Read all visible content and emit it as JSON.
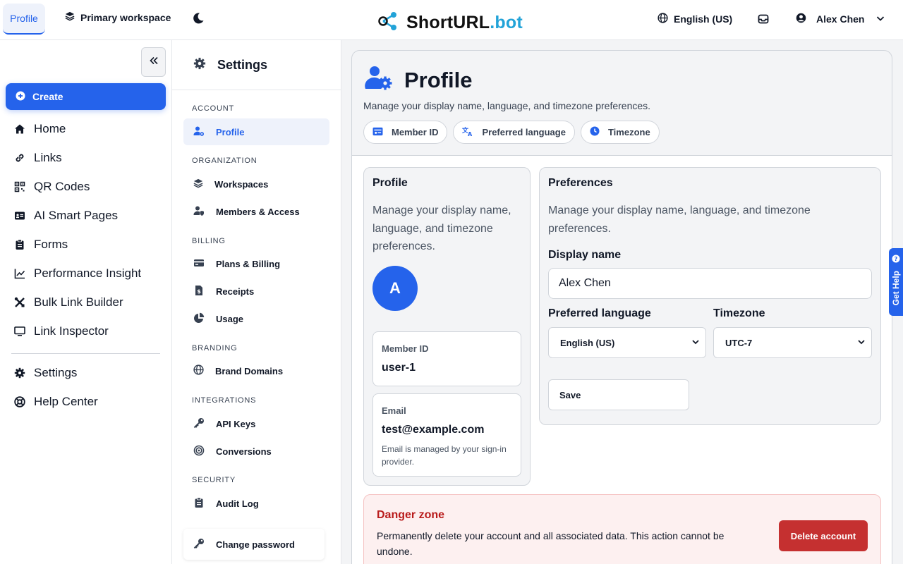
{
  "topbar": {
    "profile_tab": "Profile",
    "workspace": "Primary workspace",
    "brand_main": "ShortURL",
    "brand_accent": ".bot",
    "language": "English (US)",
    "user_name": "Alex Chen"
  },
  "nav": {
    "create": "Create",
    "items": [
      {
        "label": "Home",
        "icon": "home-icon"
      },
      {
        "label": "Links",
        "icon": "link-icon"
      },
      {
        "label": "QR Codes",
        "icon": "qr-code-icon"
      },
      {
        "label": "AI Smart Pages",
        "icon": "id-card-icon"
      },
      {
        "label": "Forms",
        "icon": "clipboard-icon"
      },
      {
        "label": "Performance Insight",
        "icon": "chart-line-icon"
      },
      {
        "label": "Bulk Link Builder",
        "icon": "tools-icon"
      },
      {
        "label": "Link Inspector",
        "icon": "monitor-icon"
      }
    ],
    "bottom_items": [
      {
        "label": "Settings",
        "icon": "gear-icon"
      },
      {
        "label": "Help Center",
        "icon": "lifebuoy-icon"
      }
    ]
  },
  "settings_nav": {
    "title": "Settings",
    "sections": {
      "account": "ACCOUNT",
      "organization": "ORGANIZATION",
      "billing": "BILLING",
      "branding": "BRANDING",
      "integrations": "INTEGRATIONS",
      "security": "SECURITY"
    },
    "items": {
      "profile": "Profile",
      "workspaces": "Workspaces",
      "members": "Members & Access",
      "plans": "Plans & Billing",
      "receipts": "Receipts",
      "usage": "Usage",
      "brand_domains": "Brand Domains",
      "api_keys": "API Keys",
      "conversions": "Conversions",
      "audit_log": "Audit Log",
      "change_password": "Change password"
    }
  },
  "page": {
    "title": "Profile",
    "description": "Manage your display name, language, and timezone preferences.",
    "chips": [
      "Member ID",
      "Preferred language",
      "Timezone"
    ]
  },
  "profile_card": {
    "title": "Profile",
    "description": "Manage your display name, language, and timezone preferences.",
    "avatar_letter": "A",
    "member_id_label": "Member ID",
    "member_id_value": "user-1",
    "email_label": "Email",
    "email_value": "test@example.com",
    "email_note": "Email is managed by your sign-in provider."
  },
  "preferences": {
    "title": "Preferences",
    "description": "Manage your display name, language, and timezone preferences.",
    "display_name_label": "Display name",
    "display_name_value": "Alex Chen",
    "language_label": "Preferred language",
    "language_value": "English (US)",
    "timezone_label": "Timezone",
    "timezone_value": "UTC-7",
    "save": "Save"
  },
  "danger": {
    "title": "Danger zone",
    "description": "Permanently delete your account and all associated data. This action cannot be undone.",
    "delete": "Delete account"
  },
  "get_help": "Get Help",
  "colors": {
    "accent": "#2563eb",
    "brand_accent": "#22a3d8",
    "danger": "#c53030"
  }
}
